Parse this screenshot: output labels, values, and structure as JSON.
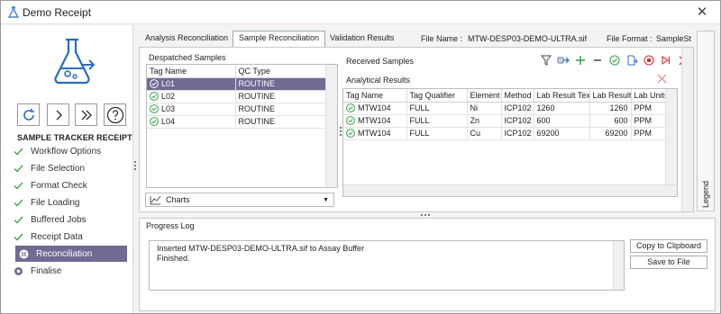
{
  "window": {
    "title": "Demo Receipt",
    "close_glyph": "✕"
  },
  "sidebar": {
    "section_title": "SAMPLE TRACKER RECEIPT",
    "buttons": [
      "refresh-icon",
      "next-icon",
      "fast-forward-icon",
      "help-icon"
    ],
    "items": [
      {
        "label": "Workflow Options",
        "state": "done"
      },
      {
        "label": "File Selection",
        "state": "done"
      },
      {
        "label": "Format Check",
        "state": "done"
      },
      {
        "label": "File Loading",
        "state": "done"
      },
      {
        "label": "Buffered Jobs",
        "state": "done"
      },
      {
        "label": "Receipt Data",
        "state": "done"
      },
      {
        "label": "Reconciliation",
        "state": "active"
      },
      {
        "label": "Finalise",
        "state": "pending"
      }
    ]
  },
  "tabs": [
    {
      "label": "Analysis Reconciliation",
      "selected": false
    },
    {
      "label": "Sample Reconciliation",
      "selected": true
    },
    {
      "label": "Validation Results",
      "selected": false
    }
  ],
  "file_info": {
    "file_name_label": "File Name :",
    "file_name_value": "MTW-DESP03-DEMO-ULTRA.sif",
    "file_format_label": "File Format :",
    "file_format_value": "SampleSt"
  },
  "despatched": {
    "title": "Despatched Samples",
    "columns": [
      "Tag Name",
      "QC Type"
    ],
    "rows": [
      {
        "tag": "L01",
        "qc": "ROUTINE",
        "selected": true
      },
      {
        "tag": "L02",
        "qc": "ROUTINE",
        "selected": false
      },
      {
        "tag": "L03",
        "qc": "ROUTINE",
        "selected": false
      },
      {
        "tag": "L04",
        "qc": "ROUTINE",
        "selected": false
      }
    ]
  },
  "charts_dropdown": {
    "label": "Charts"
  },
  "received": {
    "title": "Received Samples",
    "analytical_title": "Analytical Results",
    "toolbar": [
      "filter-icon",
      "link-icon",
      "add-icon",
      "delete-icon",
      "accept-icon",
      "export-icon",
      "stop-icon",
      "skip-icon",
      "reject-icon"
    ],
    "columns": [
      "Tag Name",
      "Tag Qualifier",
      "Element",
      "Method",
      "Lab Result Text",
      "Lab Result",
      "Lab Units"
    ],
    "rows": [
      {
        "tag": "MTW104",
        "qualifier": "FULL",
        "element": "Ni",
        "method": "ICP102",
        "result_text": "1260",
        "result": "1260",
        "units": "PPM"
      },
      {
        "tag": "MTW104",
        "qualifier": "FULL",
        "element": "Zn",
        "method": "ICP102",
        "result_text": "600",
        "result": "600",
        "units": "PPM"
      },
      {
        "tag": "MTW104",
        "qualifier": "FULL",
        "element": "Cu",
        "method": "ICP102",
        "result_text": "69200",
        "result": "69200",
        "units": "PPM"
      }
    ]
  },
  "legend": {
    "label": "Legend"
  },
  "progress": {
    "title": "Progress Log",
    "lines": [
      "Inserted MTW-DESP03-DEMO-ULTRA.sif to Assay Buffer",
      "Finished."
    ],
    "copy_button": "Copy to Clipboard",
    "save_button": "Save to File"
  },
  "colors": {
    "accent": "#6f6b92",
    "ok_green": "#3aa24a",
    "danger_red": "#d8323a",
    "icon_blue": "#2a6ebb"
  }
}
